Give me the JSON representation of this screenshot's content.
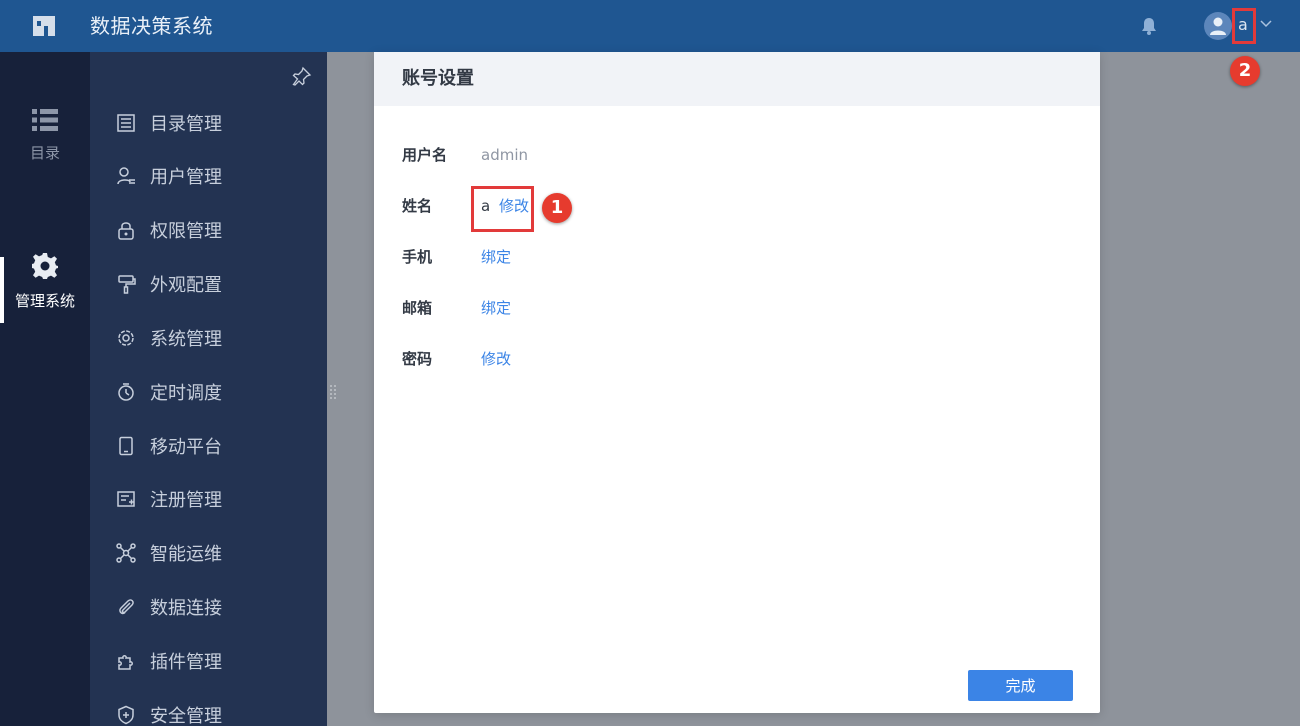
{
  "header": {
    "app_title": "数据决策系统",
    "username": "a",
    "annotation_badge": "2"
  },
  "rail": {
    "items": [
      {
        "label": "目录",
        "icon": "list-icon"
      },
      {
        "label": "管理系统",
        "icon": "gear-icon",
        "active": true
      }
    ]
  },
  "menu": {
    "items": [
      {
        "label": "目录管理",
        "icon": "catalog-icon"
      },
      {
        "label": "用户管理",
        "icon": "user-icon"
      },
      {
        "label": "权限管理",
        "icon": "lock-icon"
      },
      {
        "label": "外观配置",
        "icon": "paint-roller-icon"
      },
      {
        "label": "系统管理",
        "icon": "settings-icon"
      },
      {
        "label": "定时调度",
        "icon": "timer-icon"
      },
      {
        "label": "移动平台",
        "icon": "mobile-icon"
      },
      {
        "label": "注册管理",
        "icon": "register-icon"
      },
      {
        "label": "智能运维",
        "icon": "network-icon"
      },
      {
        "label": "数据连接",
        "icon": "paperclip-icon"
      },
      {
        "label": "插件管理",
        "icon": "puzzle-icon"
      },
      {
        "label": "安全管理",
        "icon": "shield-icon"
      }
    ]
  },
  "modal": {
    "title": "账号设置",
    "rows": [
      {
        "label": "用户名",
        "value": "admin"
      },
      {
        "label": "姓名",
        "value": "a",
        "action": "修改"
      },
      {
        "label": "手机",
        "action": "绑定"
      },
      {
        "label": "邮箱",
        "action": "绑定"
      },
      {
        "label": "密码",
        "action": "修改"
      }
    ],
    "annotation_badge": "1",
    "done_label": "完成"
  },
  "colors": {
    "header_bg": "#1f5691",
    "rail_bg": "#17213a",
    "menu_bg": "#233352",
    "link": "#3b84e6",
    "primary_button": "#3b84e6",
    "annotation_red": "#e23a3a"
  }
}
